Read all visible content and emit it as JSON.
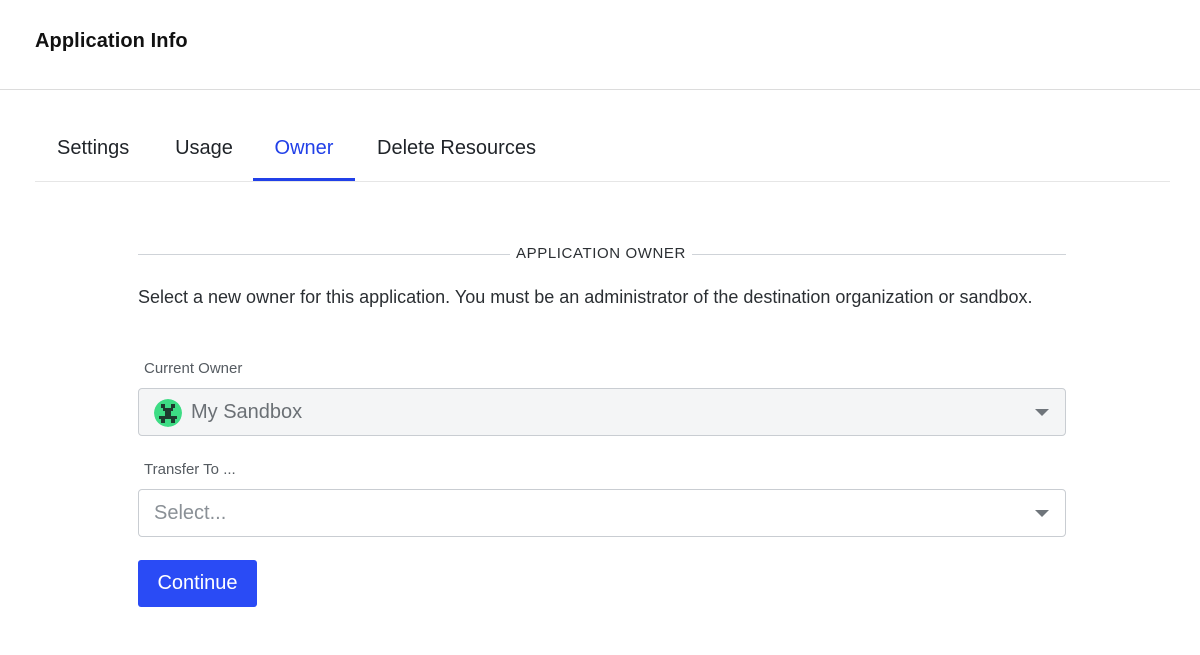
{
  "header": {
    "title": "Application Info"
  },
  "tabs": [
    {
      "label": "Settings"
    },
    {
      "label": "Usage"
    },
    {
      "label": "Owner"
    },
    {
      "label": "Delete Resources"
    }
  ],
  "active_tab": "Owner",
  "owner": {
    "section_title": "APPLICATION OWNER",
    "description": "Select a new owner for this application. You must be an administrator of the destination organization or sandbox.",
    "current_owner_label": "Current Owner",
    "current_owner_value": "My Sandbox",
    "transfer_label": "Transfer To ...",
    "transfer_placeholder": "Select...",
    "continue_label": "Continue"
  },
  "colors": {
    "accent": "#2140e8",
    "button": "#2a4bf5",
    "avatar_green": "#3ddc84",
    "avatar_dark": "#1e3a2f"
  },
  "icons": [
    "sandbox-avatar-icon",
    "chevron-down-icon"
  ]
}
